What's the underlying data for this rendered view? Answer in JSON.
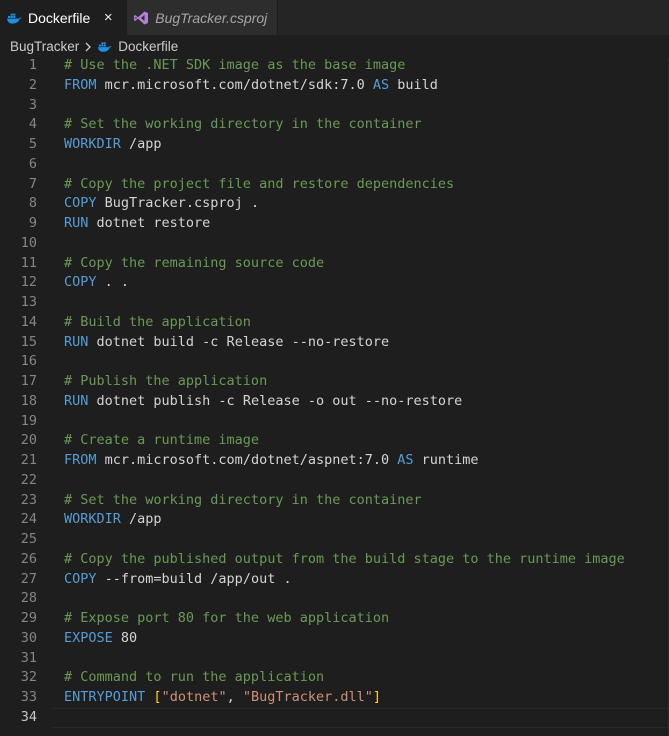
{
  "tabs": [
    {
      "label": "Dockerfile",
      "icon": "docker-icon",
      "active": true,
      "close": "×"
    },
    {
      "label": "BugTracker.csproj",
      "icon": "visual-studio-icon",
      "active": false
    }
  ],
  "breadcrumb": {
    "folder": "BugTracker",
    "file": "Dockerfile",
    "file_icon": "docker-icon"
  },
  "colors": {
    "background": "#1e1e1e",
    "comment": "#6a9955",
    "keyword": "#569cd6",
    "string": "#ce9178",
    "bracket": "#ffd700",
    "line_number": "#858585",
    "docker_blue": "#1d91e6",
    "vs_purple": "#b180d7"
  },
  "editor": {
    "current_line": 34,
    "lines": [
      [
        {
          "t": "comment",
          "v": "# Use the .NET SDK image as the base image"
        }
      ],
      [
        {
          "t": "keyword",
          "v": "FROM"
        },
        {
          "t": "plain",
          "v": " mcr.microsoft.com/dotnet/sdk:7.0 "
        },
        {
          "t": "keyword",
          "v": "AS"
        },
        {
          "t": "plain",
          "v": " build"
        }
      ],
      [],
      [
        {
          "t": "comment",
          "v": "# Set the working directory in the container"
        }
      ],
      [
        {
          "t": "keyword",
          "v": "WORKDIR"
        },
        {
          "t": "plain",
          "v": " /app"
        }
      ],
      [],
      [
        {
          "t": "comment",
          "v": "# Copy the project file and restore dependencies"
        }
      ],
      [
        {
          "t": "keyword",
          "v": "COPY"
        },
        {
          "t": "plain",
          "v": " BugTracker.csproj ."
        }
      ],
      [
        {
          "t": "keyword",
          "v": "RUN"
        },
        {
          "t": "plain",
          "v": " dotnet restore"
        }
      ],
      [],
      [
        {
          "t": "comment",
          "v": "# Copy the remaining source code"
        }
      ],
      [
        {
          "t": "keyword",
          "v": "COPY"
        },
        {
          "t": "plain",
          "v": " . ."
        }
      ],
      [],
      [
        {
          "t": "comment",
          "v": "# Build the application"
        }
      ],
      [
        {
          "t": "keyword",
          "v": "RUN"
        },
        {
          "t": "plain",
          "v": " dotnet build -c Release --no-restore"
        }
      ],
      [],
      [
        {
          "t": "comment",
          "v": "# Publish the application"
        }
      ],
      [
        {
          "t": "keyword",
          "v": "RUN"
        },
        {
          "t": "plain",
          "v": " dotnet publish -c Release -o out --no-restore"
        }
      ],
      [],
      [
        {
          "t": "comment",
          "v": "# Create a runtime image"
        }
      ],
      [
        {
          "t": "keyword",
          "v": "FROM"
        },
        {
          "t": "plain",
          "v": " mcr.microsoft.com/dotnet/aspnet:7.0 "
        },
        {
          "t": "keyword",
          "v": "AS"
        },
        {
          "t": "plain",
          "v": " runtime"
        }
      ],
      [],
      [
        {
          "t": "comment",
          "v": "# Set the working directory in the container"
        }
      ],
      [
        {
          "t": "keyword",
          "v": "WORKDIR"
        },
        {
          "t": "plain",
          "v": " /app"
        }
      ],
      [],
      [
        {
          "t": "comment",
          "v": "# Copy the published output from the build stage to the runtime image"
        }
      ],
      [
        {
          "t": "keyword",
          "v": "COPY"
        },
        {
          "t": "plain",
          "v": " --from=build /app/out ."
        }
      ],
      [],
      [
        {
          "t": "comment",
          "v": "# Expose port 80 for the web application"
        }
      ],
      [
        {
          "t": "keyword",
          "v": "EXPOSE"
        },
        {
          "t": "plain",
          "v": " 80"
        }
      ],
      [],
      [
        {
          "t": "comment",
          "v": "# Command to run the application"
        }
      ],
      [
        {
          "t": "keyword",
          "v": "ENTRYPOINT"
        },
        {
          "t": "plain",
          "v": " "
        },
        {
          "t": "bracket",
          "v": "["
        },
        {
          "t": "string",
          "v": "\"dotnet\""
        },
        {
          "t": "plain",
          "v": ", "
        },
        {
          "t": "string",
          "v": "\"BugTracker.dll\""
        },
        {
          "t": "bracket",
          "v": "]"
        }
      ],
      []
    ]
  }
}
